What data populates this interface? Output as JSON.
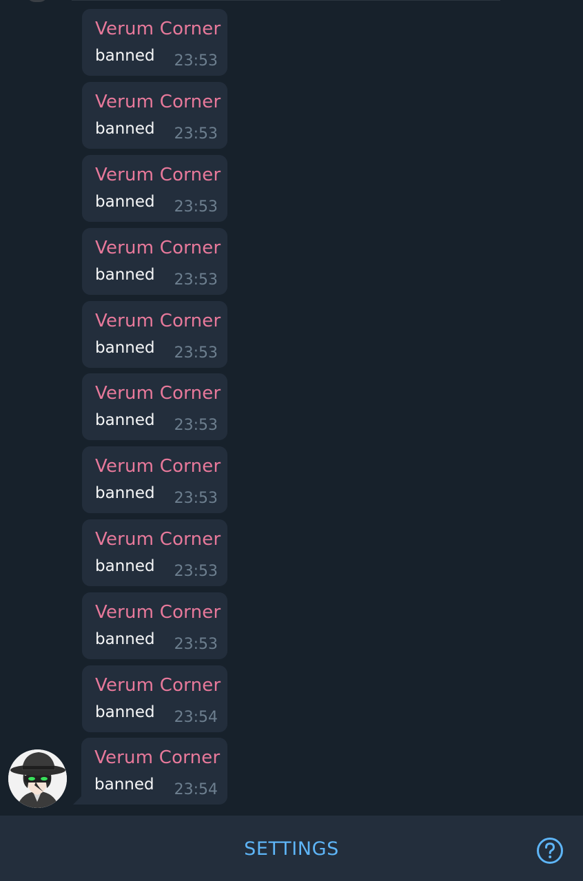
{
  "colors": {
    "background": "#17212b",
    "bubble": "#232e3c",
    "sender_name": "#e8799b",
    "message_text": "#f5f6f7",
    "timestamp": "#6d7f8f",
    "accent": "#5eb5f7",
    "bottom_bar": "#232e3c"
  },
  "messages": [
    {
      "sender": "Verum Corner",
      "text": "banned",
      "time": "23:53"
    },
    {
      "sender": "Verum Corner",
      "text": "banned",
      "time": "23:53"
    },
    {
      "sender": "Verum Corner",
      "text": "banned",
      "time": "23:53"
    },
    {
      "sender": "Verum Corner",
      "text": "banned",
      "time": "23:53"
    },
    {
      "sender": "Verum Corner",
      "text": "banned",
      "time": "23:53"
    },
    {
      "sender": "Verum Corner",
      "text": "banned",
      "time": "23:53"
    },
    {
      "sender": "Verum Corner",
      "text": "banned",
      "time": "23:53"
    },
    {
      "sender": "Verum Corner",
      "text": "banned",
      "time": "23:53"
    },
    {
      "sender": "Verum Corner",
      "text": "banned",
      "time": "23:53"
    },
    {
      "sender": "Verum Corner",
      "text": "banned",
      "time": "23:54"
    },
    {
      "sender": "Verum Corner",
      "text": "banned",
      "time": "23:54"
    }
  ],
  "sender_avatar": {
    "icon": "user-avatar-hat-icon"
  },
  "bottom_bar": {
    "settings_label": "SETTINGS",
    "help_icon": "help-question-icon"
  }
}
